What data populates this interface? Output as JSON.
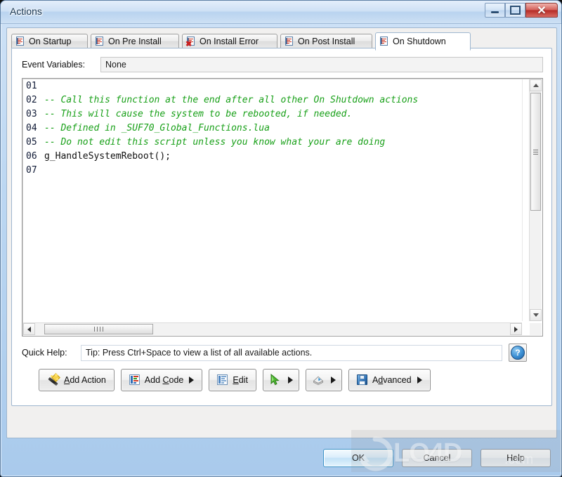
{
  "window": {
    "title": "Actions",
    "controls": {
      "minimize": "minimize-button",
      "maximize": "maximize-button",
      "close": "✕"
    }
  },
  "tabs": [
    {
      "label": "On Startup",
      "icon": "script-document-icon",
      "active": false
    },
    {
      "label": "On Pre Install",
      "icon": "script-document-icon",
      "active": false
    },
    {
      "label": "On Install Error",
      "icon": "script-document-error-icon",
      "active": false
    },
    {
      "label": "On Post Install",
      "icon": "script-document-icon",
      "active": false
    },
    {
      "label": "On Shutdown",
      "icon": "script-document-icon",
      "active": true
    }
  ],
  "event_variables": {
    "label": "Event Variables:",
    "value": "None"
  },
  "editor": {
    "lines": [
      {
        "num": "01",
        "text": "",
        "comment": false
      },
      {
        "num": "02",
        "text": "-- Call this function at the end after all other On Shutdown actions",
        "comment": true
      },
      {
        "num": "03",
        "text": "-- This will cause the system to be rebooted, if needed.",
        "comment": true
      },
      {
        "num": "04",
        "text": "-- Defined in _SUF70_Global_Functions.lua",
        "comment": true
      },
      {
        "num": "05",
        "text": "-- Do not edit this script unless you know what your are doing",
        "comment": true
      },
      {
        "num": "06",
        "text": "g_HandleSystemReboot();",
        "comment": false
      },
      {
        "num": "07",
        "text": "",
        "comment": false
      }
    ],
    "comment_color": "#18a018",
    "code_color": "#111111",
    "linenumber_color": "#101a36"
  },
  "quick_help": {
    "label": "Quick Help:",
    "value": "Tip: Press Ctrl+Space to view a list of all available actions.",
    "help_button": "?"
  },
  "toolbar": [
    {
      "name": "add-action-button",
      "label": "Add Action",
      "underline": "A",
      "icon": "magic-wand-icon",
      "has_caret": false
    },
    {
      "name": "add-code-button",
      "label": "Add Code",
      "underline": "C",
      "icon": "code-document-icon",
      "has_caret": true
    },
    {
      "name": "edit-button",
      "label": "Edit",
      "underline": "E",
      "icon": "edit-document-icon",
      "has_caret": false
    },
    {
      "name": "run-button",
      "label": "",
      "underline": "",
      "icon": "green-cursor-icon",
      "has_caret": true
    },
    {
      "name": "package-button",
      "label": "",
      "underline": "",
      "icon": "package-box-icon",
      "has_caret": true
    },
    {
      "name": "advanced-button",
      "label": "Advanced",
      "underline": "d",
      "icon": "floppy-save-icon",
      "has_caret": true
    }
  ],
  "footer": {
    "ok": "OK",
    "cancel": "Cancel",
    "help": "Help"
  },
  "watermark": {
    "text": "LO4D",
    "suffix": ".com"
  }
}
